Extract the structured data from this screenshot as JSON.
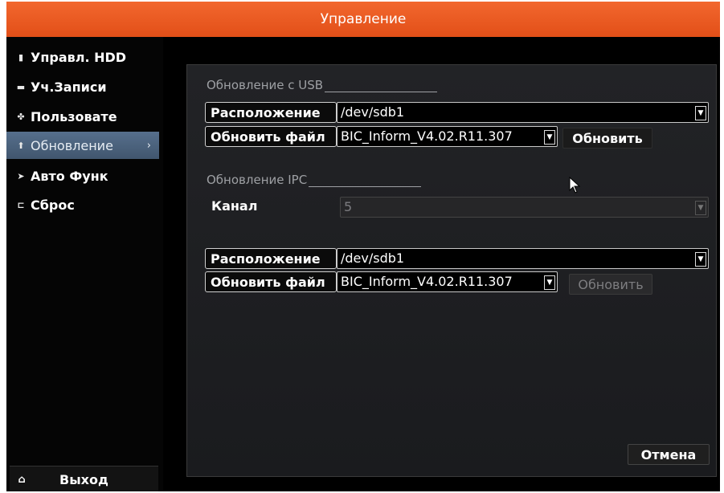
{
  "window": {
    "title": "Управление"
  },
  "sidebar": {
    "items": [
      {
        "label": "Управл. HDD",
        "icon": "hdd-icon"
      },
      {
        "label": "Уч.Записи",
        "icon": "folder-icon"
      },
      {
        "label": "Пользовате",
        "icon": "users-icon"
      },
      {
        "label": "Обновление",
        "icon": "upload-icon",
        "active": true
      },
      {
        "label": "Авто Функ",
        "icon": "auto-icon"
      },
      {
        "label": "Сброс",
        "icon": "reset-icon"
      }
    ],
    "exit_label": "Выход"
  },
  "usb": {
    "section_title": "Обновление с USB",
    "location_label": "Расположение",
    "location_value": "/dev/sdb1",
    "file_label": "Обновить файл",
    "file_value": "BIC_Inform_V4.02.R11.307",
    "update_button": "Обновить"
  },
  "ipc": {
    "section_title": "Обновление IPC",
    "channel_label": "Канал",
    "channel_value": "5",
    "location_label": "Расположение",
    "location_value": "/dev/sdb1",
    "file_label": "Обновить файл",
    "file_value": "BIC_Inform_V4.02.R11.307",
    "update_button": "Обновить"
  },
  "footer": {
    "cancel_button": "Отмена"
  },
  "colors": {
    "title_bar": "#e85a21",
    "active_item": "#4d6580",
    "panel": "#1f2023"
  }
}
